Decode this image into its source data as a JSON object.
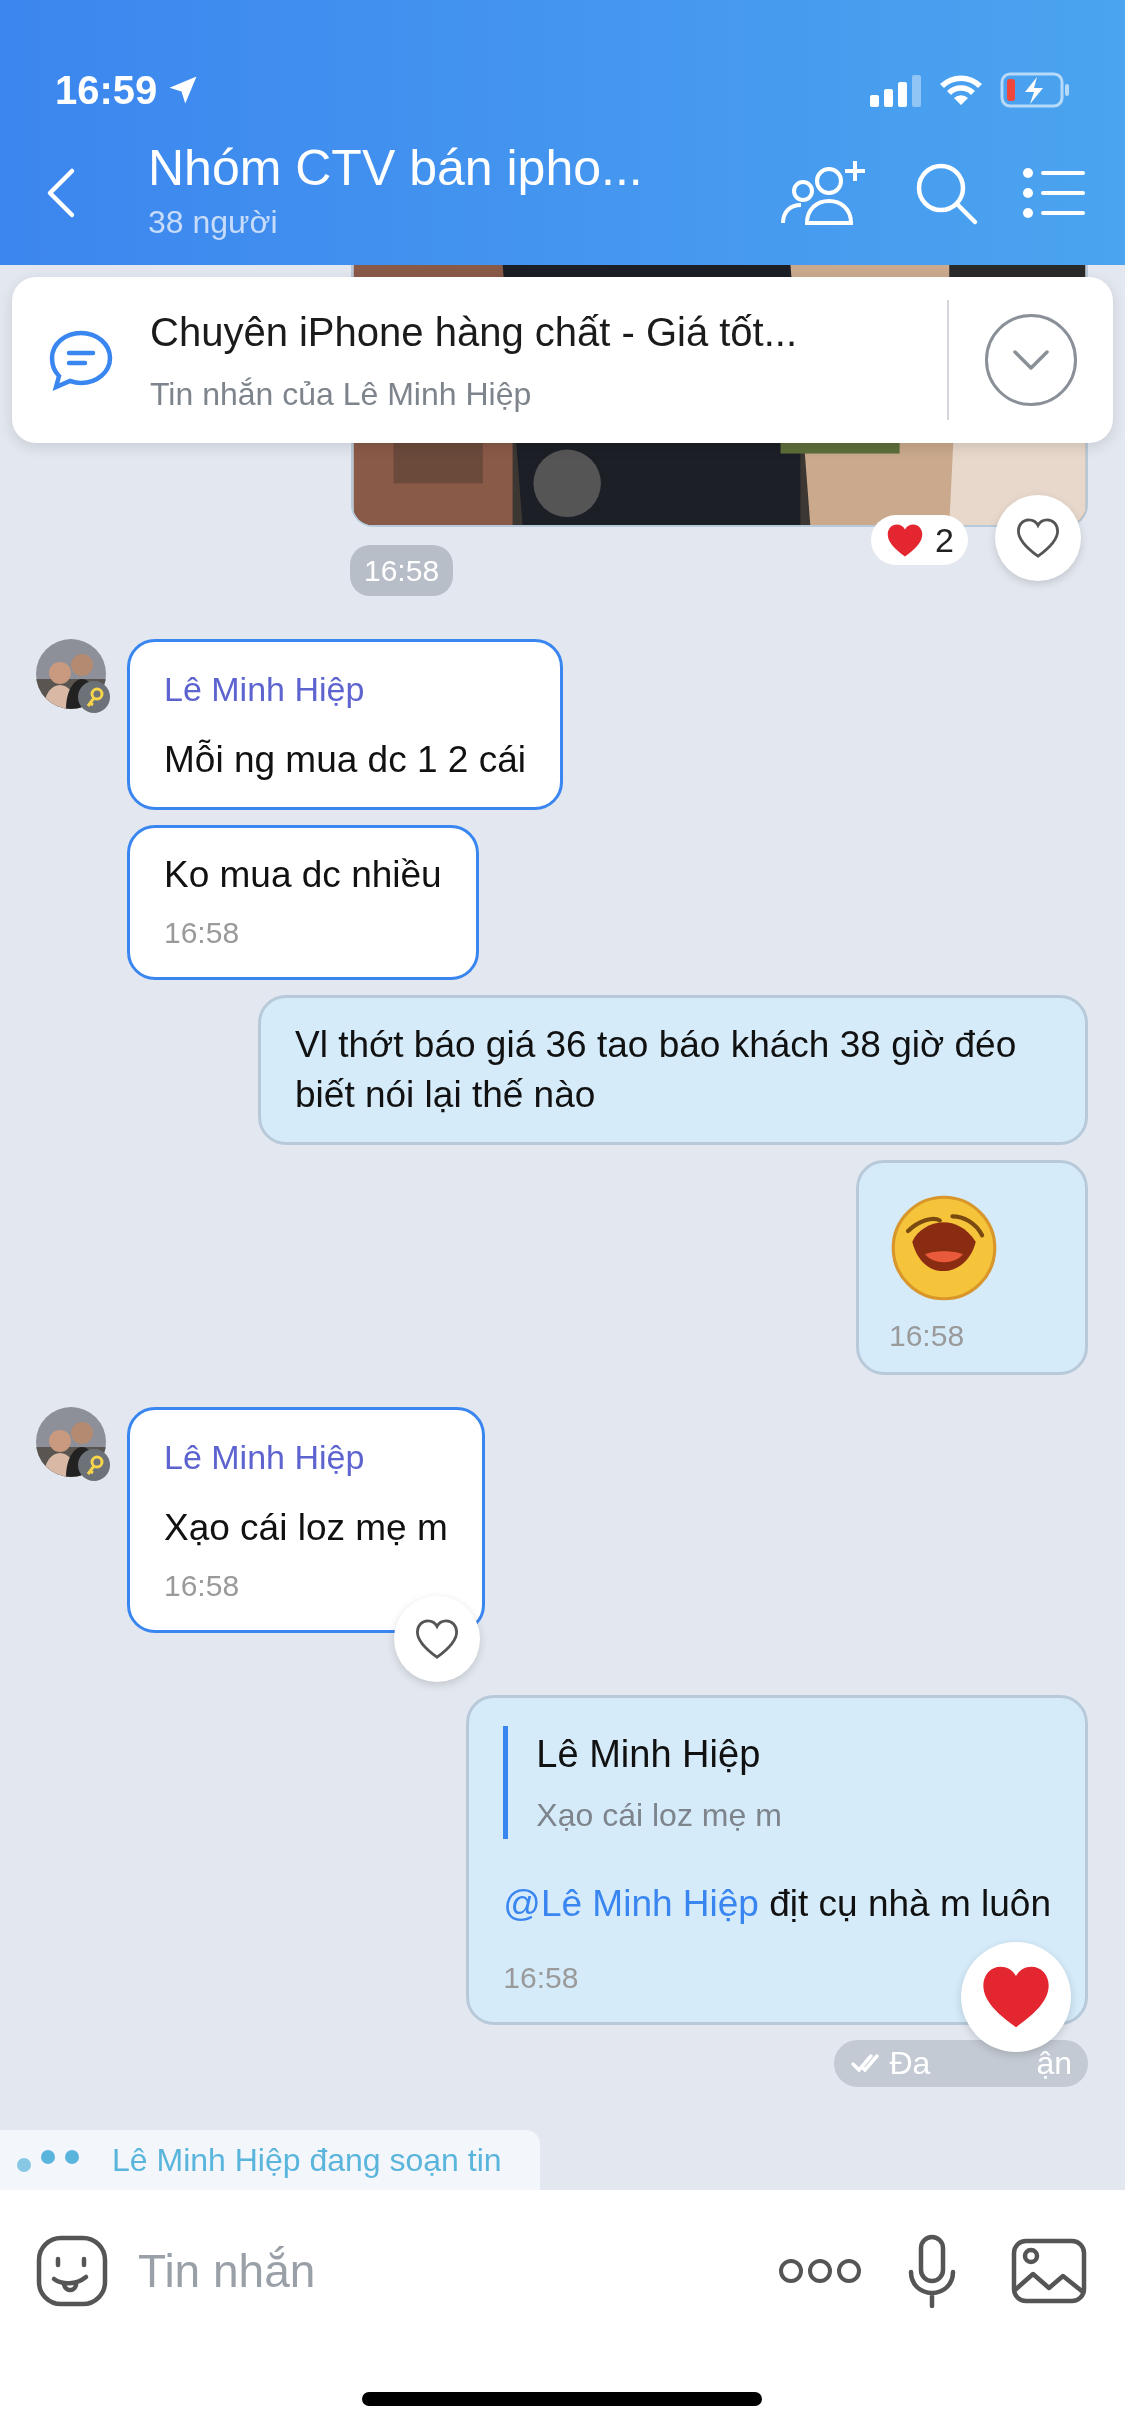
{
  "status_bar": {
    "time": "16:59"
  },
  "header": {
    "title": "Nhóm CTV bán ipho...",
    "subtitle": "38 người"
  },
  "pinned": {
    "title": "Chuyên iPhone hàng chất - Giá tốt...",
    "subtitle": "Tin nhắn của Lê Minh Hiệp"
  },
  "messages": [
    {
      "kind": "picture",
      "outgoing": true,
      "reaction_count": "2",
      "liked": false
    },
    {
      "kind": "timestamp",
      "text": "16:58"
    },
    {
      "kind": "text",
      "outgoing": false,
      "sender": "Lê Minh Hiệp",
      "text": "Mỗi ng mua dc 1 2 cái"
    },
    {
      "kind": "text",
      "outgoing": false,
      "text": "Ko mua dc nhiều",
      "time": "16:58"
    },
    {
      "kind": "text",
      "outgoing": true,
      "text": "Vl thớt báo giá 36 tao báo khách 38 giờ đéo biết nói lại thế nào"
    },
    {
      "kind": "sticker",
      "outgoing": true,
      "time": "16:58"
    },
    {
      "kind": "text",
      "outgoing": false,
      "sender": "Lê Minh Hiệp",
      "text": "Xạo cái loz mẹ m",
      "time": "16:58",
      "liked": false
    },
    {
      "kind": "reply",
      "outgoing": true,
      "quote_sender": "Lê Minh Hiệp",
      "quote_text": "Xạo cái loz mẹ m",
      "mention": "@Lê Minh Hiệp",
      "text": "địt cụ nhà m luôn",
      "time": "16:58",
      "status_parts": [
        "Đa",
        "ận"
      ],
      "liked": true
    }
  ],
  "typing": {
    "text": "Lê Minh Hiệp đang soạn tin"
  },
  "composer": {
    "placeholder": "Tin nhắn"
  }
}
